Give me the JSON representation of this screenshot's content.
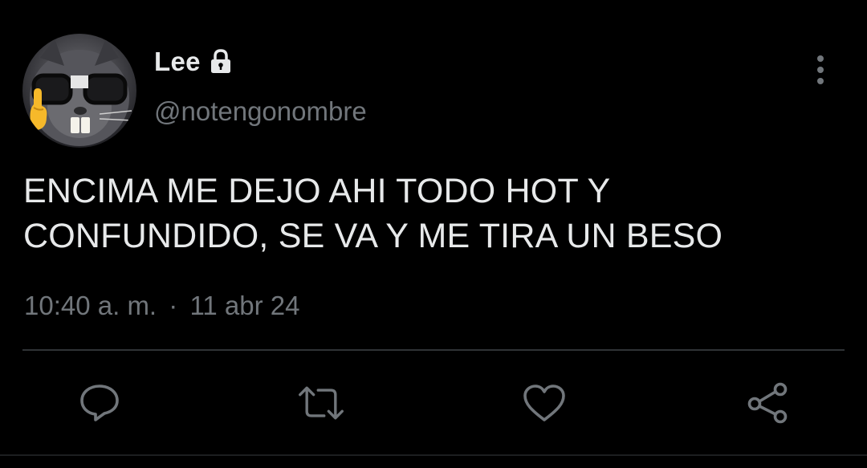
{
  "user": {
    "display_name": "Lee",
    "handle": "@notengonombre",
    "protected_icon": "lock-icon",
    "avatar_icon": "cat-with-glasses-avatar"
  },
  "tweet": {
    "lines": [
      "ENCIMA ME DEJO AHI TODO HOT Y",
      "CONFUNDIDO, SE VA Y ME TIRA UN BESO"
    ],
    "time": "10:40 a. m.",
    "separator": "·",
    "date": "11 abr 24"
  },
  "actions": [
    {
      "icon": "reply-icon"
    },
    {
      "icon": "retweet-icon"
    },
    {
      "icon": "like-icon"
    },
    {
      "icon": "share-icon"
    }
  ],
  "menu": {
    "icon": "more-options-icon"
  },
  "colors": {
    "background": "#000000",
    "primary_text": "#e7e9ea",
    "secondary_text": "#71767b",
    "divider": "#2f3336"
  }
}
